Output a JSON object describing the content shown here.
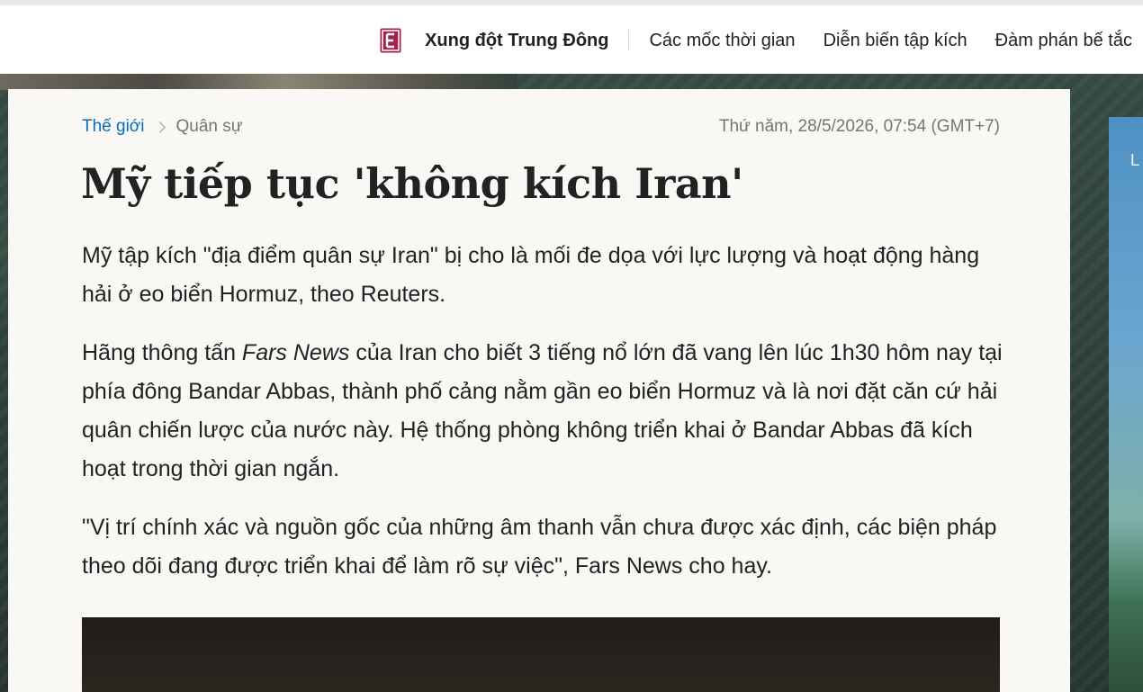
{
  "topnav": {
    "title": "Xung đột Trung Đông",
    "links": [
      "Các mốc thời gian",
      "Diễn biến tập kích",
      "Đàm phán bế tắc"
    ],
    "logo_color": "#a0234a"
  },
  "article": {
    "breadcrumb": [
      "Thế giới",
      "Quân sự"
    ],
    "date": "Thứ năm, 28/5/2026, 07:54 (GMT+7)",
    "title": "Mỹ tiếp tục 'không kích Iran'",
    "lead": "Mỹ tập kích \"địa điểm quân sự Iran\" bị cho là mối đe dọa với lực lượng và hoạt động hàng hải ở eo biển Hormuz, theo Reuters.",
    "para1": {
      "before": "Hãng thông tấn ",
      "source": "Fars News",
      "after": " của Iran cho biết 3 tiếng nổ lớn đã vang lên lúc 1h30 hôm nay tại phía đông Bandar Abbas, thành phố cảng nằm gần eo biển Hormuz và là nơi đặt căn cứ hải quân chiến lược của nước này. Hệ thống phòng không triển khai ở Bandar Abbas đã kích hoạt trong thời gian ngắn."
    },
    "para2": "\"Vị trí chính xác và nguồn gốc của những âm thanh vẫn chưa được xác định, các biện pháp theo dõi đang được triển khai để làm rõ sự việc\", Fars News cho hay."
  },
  "side_ad": {
    "letter": "L"
  },
  "colors": {
    "link_blue": "#076db6",
    "muted": "#757575",
    "card_bg": "#f9f8f5"
  }
}
